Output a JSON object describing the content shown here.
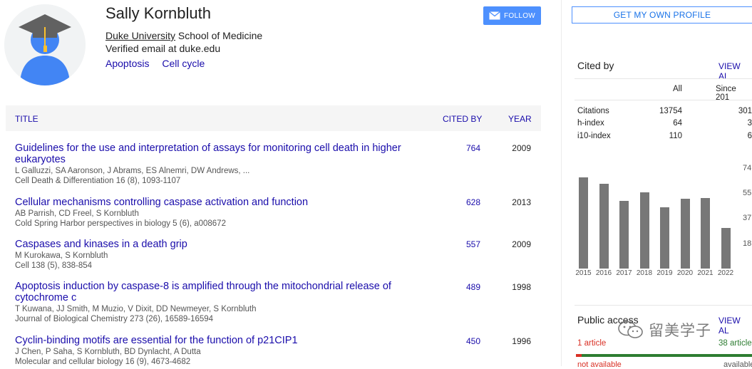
{
  "profile": {
    "name": "Sally Kornbluth",
    "affiliation_link": "Duke University",
    "affiliation_rest": " School of Medicine",
    "email": "Verified email at duke.edu",
    "interests": [
      "Apoptosis",
      "Cell cycle"
    ],
    "follow_label": "FOLLOW",
    "accent": "#4d90fe"
  },
  "table": {
    "headers": {
      "title": "TITLE",
      "cited_by": "CITED BY",
      "year": "YEAR"
    },
    "articles": [
      {
        "title_line1": "Guidelines for the use and interpretation of assays for monitoring cell death in higher",
        "title_line2": "eukaryotes",
        "authors": "L Galluzzi, SA Aaronson, J Abrams, ES Alnemri, DW Andrews, ...",
        "venue": "Cell Death & Differentiation 16 (8), 1093-1107",
        "cited_by": "764",
        "year": "2009"
      },
      {
        "title_line1": "Cellular mechanisms controlling caspase activation and function",
        "title_line2": "",
        "authors": "AB Parrish, CD Freel, S Kornbluth",
        "venue": "Cold Spring Harbor perspectives in biology 5 (6), a008672",
        "cited_by": "628",
        "year": "2013"
      },
      {
        "title_line1": "Caspases and kinases in a death grip",
        "title_line2": "",
        "authors": "M Kurokawa, S Kornbluth",
        "venue": "Cell 138 (5), 838-854",
        "cited_by": "557",
        "year": "2009"
      },
      {
        "title_line1": "Apoptosis induction by caspase-8 is amplified through the mitochondrial release of",
        "title_line2": "cytochrome c",
        "authors": "T Kuwana, JJ Smith, M Muzio, V Dixit, DD Newmeyer, S Kornbluth",
        "venue": "Journal of Biological Chemistry 273 (26), 16589-16594",
        "cited_by": "489",
        "year": "1998"
      },
      {
        "title_line1": "Cyclin-binding motifs are essential for the function of p21CIP1",
        "title_line2": "",
        "authors": "J Chen, P Saha, S Kornbluth, BD Dynlacht, A Dutta",
        "venue": "Molecular and cellular biology 16 (9), 4673-4682",
        "cited_by": "450",
        "year": "1996"
      }
    ]
  },
  "sidebar": {
    "get_profile": "GET MY OWN PROFILE",
    "cited_by_title": "Cited by",
    "view_all": "VIEW AL",
    "col_all": "All",
    "col_since": "Since 201",
    "metrics": [
      {
        "label": "Citations",
        "all": "13754",
        "since": "301"
      },
      {
        "label": "h-index",
        "all": "64",
        "since": "3"
      },
      {
        "label": "i10-index",
        "all": "110",
        "since": "6"
      }
    ],
    "public_access_title": "Public access",
    "public_view_all": "VIEW AL",
    "not_available_count": "1 article",
    "available_count": "38 article",
    "not_available_label": "not available",
    "available_label": "available"
  },
  "chart_data": {
    "type": "bar",
    "categories": [
      "2015",
      "2016",
      "2017",
      "2018",
      "2019",
      "2020",
      "2021",
      "2022"
    ],
    "values": [
      700,
      650,
      520,
      585,
      470,
      535,
      545,
      310
    ],
    "ytick_labels": [
      "74",
      "55",
      "37",
      "18"
    ],
    "ylim": [
      0,
      740
    ],
    "bar_color": "#777777"
  },
  "watermark": {
    "text": "留美学子"
  }
}
